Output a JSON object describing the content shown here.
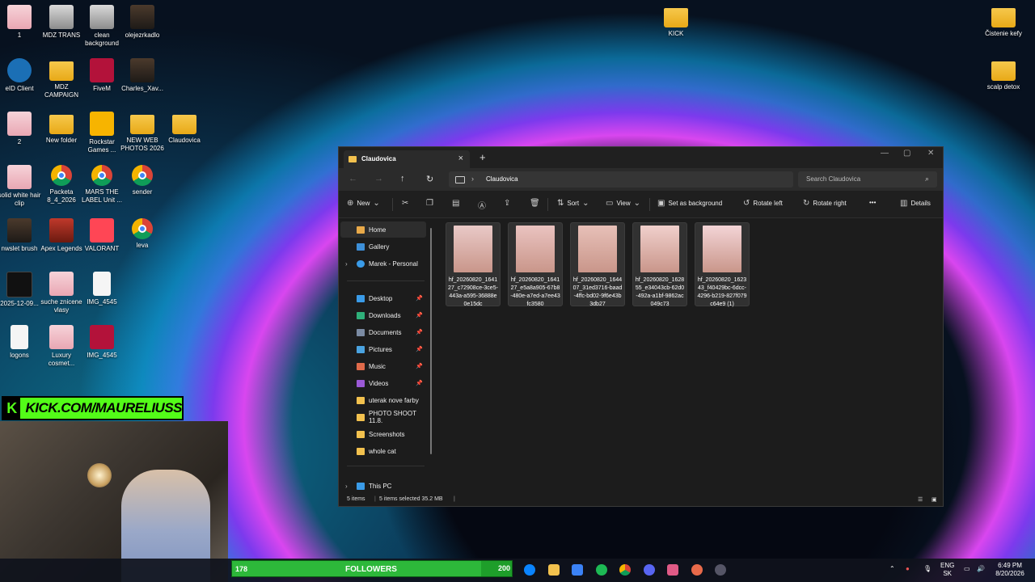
{
  "desktop_icons": [
    {
      "label": "1",
      "icon": "photo-pink"
    },
    {
      "label": "MDZ TRANS",
      "icon": "photo-gray"
    },
    {
      "label": "clean background",
      "icon": "photo-gray"
    },
    {
      "label": "olejezrkadlo",
      "icon": "photo-dark"
    },
    {
      "label": "eID Client",
      "icon": "eid"
    },
    {
      "label": "MDZ CAMPAIGN",
      "icon": "folder"
    },
    {
      "label": "FiveM",
      "icon": "red"
    },
    {
      "label": "Charles_Xav...",
      "icon": "photo-dark"
    },
    {
      "label": "2",
      "icon": "photo-pink"
    },
    {
      "label": "New folder",
      "icon": "folder"
    },
    {
      "label": "Rockstar Games ...",
      "icon": "rock"
    },
    {
      "label": "NEW WEB PHOTOS 2026",
      "icon": "folder"
    },
    {
      "label": "Claudovica",
      "icon": "folder"
    },
    {
      "label": "solid white hair clip",
      "icon": "photo-pink"
    },
    {
      "label": "Packeta 8_4_2026",
      "icon": "chrome"
    },
    {
      "label": "MARS THE LABEL Unit ...",
      "icon": "chrome"
    },
    {
      "label": "sender",
      "icon": "chrome"
    },
    {
      "label": "nwslet brush",
      "icon": "photo-dark"
    },
    {
      "label": "Apex Legends",
      "icon": "apex"
    },
    {
      "label": "VALORANT",
      "icon": "val"
    },
    {
      "label": "leva",
      "icon": "chrome"
    },
    {
      "label": "2025-12-09...",
      "icon": "black"
    },
    {
      "label": "suche znicene vlasy",
      "icon": "photo-pink"
    },
    {
      "label": "IMG_4545",
      "icon": "doc"
    },
    {
      "label": "logons",
      "icon": "doc"
    },
    {
      "label": "Luxury cosmet...",
      "icon": "photo-pink"
    },
    {
      "label": "IMG_4545",
      "icon": "red"
    },
    {
      "label": "KICK",
      "icon": "folder"
    },
    {
      "label": "Čistenie kefy",
      "icon": "folder"
    },
    {
      "label": "scalp detox",
      "icon": "folder"
    }
  ],
  "explorer": {
    "tab_title": "Claudovica",
    "new_tab": "+",
    "address_path": "Claudovica",
    "search_placeholder": "Search Claudovica",
    "toolbar": {
      "new": "New",
      "sort": "Sort",
      "view": "View",
      "set_bg": "Set as background",
      "rotate_left": "Rotate left",
      "rotate_right": "Rotate right",
      "more": "•••",
      "details": "Details"
    },
    "nav": {
      "home": "Home",
      "gallery": "Gallery",
      "marek": "Marek - Personal",
      "desktop": "Desktop",
      "downloads": "Downloads",
      "documents": "Documents",
      "pictures": "Pictures",
      "music": "Music",
      "videos": "Videos",
      "folder1": "uterak nove farby",
      "folder2": "PHOTO SHOOT 11.8.",
      "folder3": "Screenshots",
      "folder4": "whole cat",
      "thispc": "This PC"
    },
    "files": [
      {
        "name": "hf_20260820_164127_c72908ce-3ce5-443a-a595-36888e0e15dc",
        "tint": "#e9c9c7"
      },
      {
        "name": "hf_20260820_164127_e5a8a905-67b8-480e-a7ed-a7ee43fc3580",
        "tint": "#eac3c0"
      },
      {
        "name": "hf_20260820_164407_31ed3716-baad-4ffc-bd02-9f6e43b3db27",
        "tint": "#e7c0b8"
      },
      {
        "name": "hf_20260820_162855_e34043cb-62d0-492a-a1bf-9862ac049c73",
        "tint": "#f0d0cc"
      },
      {
        "name": "hf_20260820_162343_f40429bc-6dcc-4296-b219-827f079c64e9 (1)",
        "tint": "#f3d4d6"
      }
    ],
    "status": {
      "items": "5 items",
      "selected": "5 items selected  35.2 MB"
    }
  },
  "kick_banner": "KICK.COM/MAURELIUSS",
  "followers": {
    "count": "178",
    "label": "FOLLOWERS",
    "goal": "200",
    "progress": 0.89
  },
  "tray": {
    "lang1": "ENG",
    "lang2": "SK",
    "time": "6:49 PM",
    "date": "8/20/2026"
  }
}
